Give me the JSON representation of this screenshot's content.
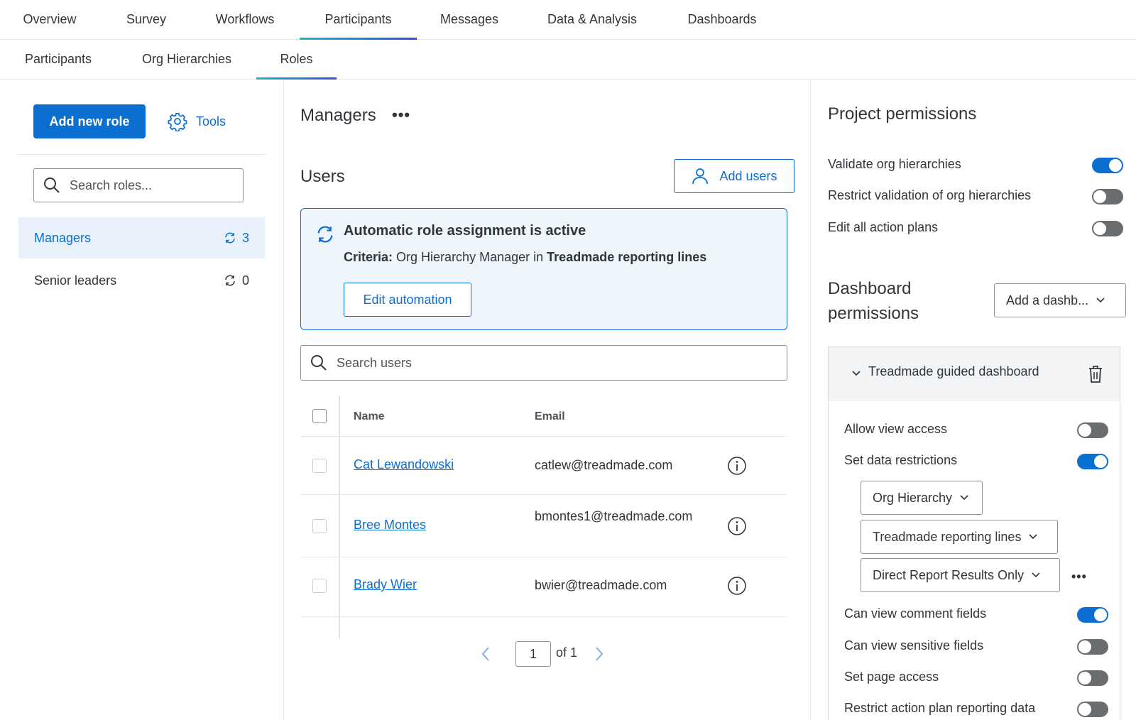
{
  "top_nav": {
    "tabs": [
      "Overview",
      "Survey",
      "Workflows",
      "Participants",
      "Messages",
      "Data & Analysis",
      "Dashboards"
    ],
    "active": "Participants"
  },
  "sub_nav": {
    "tabs": [
      "Participants",
      "Org Hierarchies",
      "Roles"
    ],
    "active": "Roles"
  },
  "left": {
    "add_role_label": "Add new role",
    "tools_label": "Tools",
    "search_placeholder": "Search roles...",
    "roles": [
      {
        "name": "Managers",
        "count": "3"
      },
      {
        "name": "Senior leaders",
        "count": "0"
      }
    ]
  },
  "middle": {
    "role_title": "Managers",
    "users_heading": "Users",
    "add_users_label": "Add users",
    "auto": {
      "title": "Automatic role assignment is active",
      "criteria_label": "Criteria:",
      "criteria_field": "Org Hierarchy Manager",
      "criteria_in": "in",
      "criteria_value": "Treadmade reporting lines",
      "edit_label": "Edit automation"
    },
    "search_users_placeholder": "Search users",
    "table": {
      "headers": {
        "name": "Name",
        "email": "Email"
      },
      "rows": [
        {
          "name": "Cat Lewandowski",
          "email": "catlew@treadmade.com"
        },
        {
          "name": "Bree Montes",
          "email": "bmontes1@treadmade.com"
        },
        {
          "name": "Brady Wier",
          "email": "bwier@treadmade.com"
        }
      ]
    },
    "pagination": {
      "page": "1",
      "of_label": "of 1"
    }
  },
  "right": {
    "project_heading": "Project permissions",
    "project_perms": [
      {
        "label": "Validate org hierarchies",
        "on": true
      },
      {
        "label": "Restrict validation of org hierarchies",
        "on": false
      },
      {
        "label": "Edit all action plans",
        "on": false
      }
    ],
    "dashboard_heading": "Dashboard permissions",
    "add_dashboard_label": "Add a dashb...",
    "dashboard": {
      "name": "Treadmade guided dashboard",
      "perms": [
        {
          "label": "Allow view access",
          "on": false
        },
        {
          "label": "Set data restrictions",
          "on": true
        },
        {
          "label": "Can view comment fields",
          "on": true
        },
        {
          "label": "Can view sensitive fields",
          "on": false
        },
        {
          "label": "Set page access",
          "on": false
        },
        {
          "label": "Restrict action plan reporting data",
          "on": false
        }
      ],
      "restrictions": [
        "Org Hierarchy",
        "Treadmade reporting lines",
        "Direct Report Results Only"
      ]
    }
  },
  "colors": {
    "accent": "#0b6ed1",
    "toggle_off": "#6a6d70",
    "selected_bg": "#e8f1fb"
  }
}
